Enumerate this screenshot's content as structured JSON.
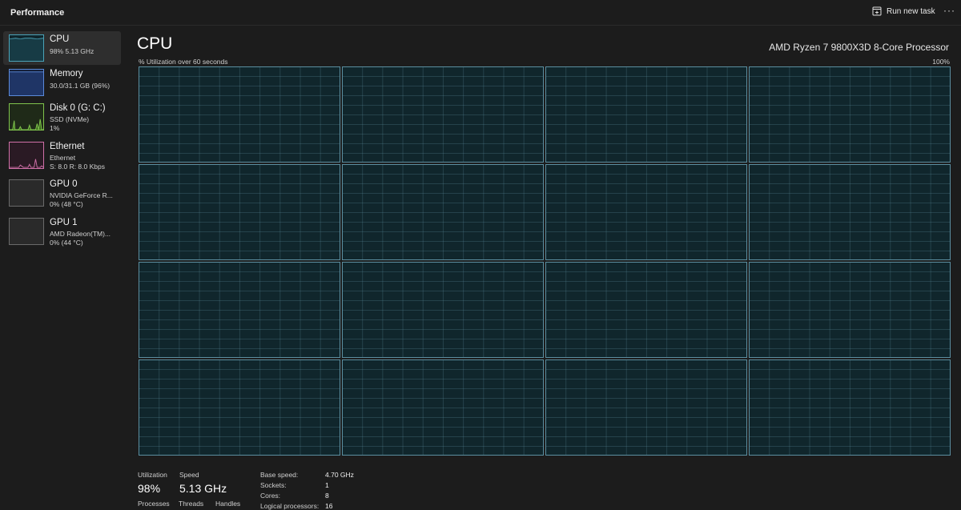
{
  "header": {
    "title": "Performance",
    "run_new_task": "Run new task",
    "more": "···"
  },
  "sidebar": {
    "items": [
      {
        "name": "CPU",
        "sub1": "98%  5.13 GHz",
        "sub2": "",
        "color": "#4ba3b8",
        "icon": "cpu-graph-thumbnail"
      },
      {
        "name": "Memory",
        "sub1": "30.0/31.1 GB (96%)",
        "sub2": "",
        "color": "#5b8ad9",
        "icon": "memory-graph-thumbnail"
      },
      {
        "name": "Disk 0 (G: C:)",
        "sub1": "SSD (NVMe)",
        "sub2": "1%",
        "color": "#7fc34c",
        "icon": "disk-graph-thumbnail"
      },
      {
        "name": "Ethernet",
        "sub1": "Ethernet",
        "sub2": "S: 8.0  R: 8.0 Kbps",
        "color": "#d070a8",
        "icon": "ethernet-graph-thumbnail"
      },
      {
        "name": "GPU 0",
        "sub1": "NVIDIA GeForce R...",
        "sub2": "0%  (48 °C)",
        "color": "#8a8a8a",
        "icon": "gpu-graph-thumbnail"
      },
      {
        "name": "GPU 1",
        "sub1": "AMD Radeon(TM)...",
        "sub2": "0%  (44 °C)",
        "color": "#8a8a8a",
        "icon": "gpu-graph-thumbnail"
      }
    ]
  },
  "main": {
    "title": "CPU",
    "processor": "AMD Ryzen 7 9800X3D 8-Core Processor",
    "graph_caption": "% Utilization over 60 seconds",
    "graph_max": "100%",
    "core_count": 16,
    "stats": {
      "utilization_label": "Utilization",
      "utilization_value": "98%",
      "speed_label": "Speed",
      "speed_value": "5.13 GHz",
      "processes_label": "Processes",
      "threads_label": "Threads",
      "handles_label": "Handles"
    },
    "specs": [
      {
        "label": "Base speed:",
        "value": "4.70 GHz"
      },
      {
        "label": "Sockets:",
        "value": "1"
      },
      {
        "label": "Cores:",
        "value": "8"
      },
      {
        "label": "Logical processors:",
        "value": "16"
      }
    ]
  }
}
